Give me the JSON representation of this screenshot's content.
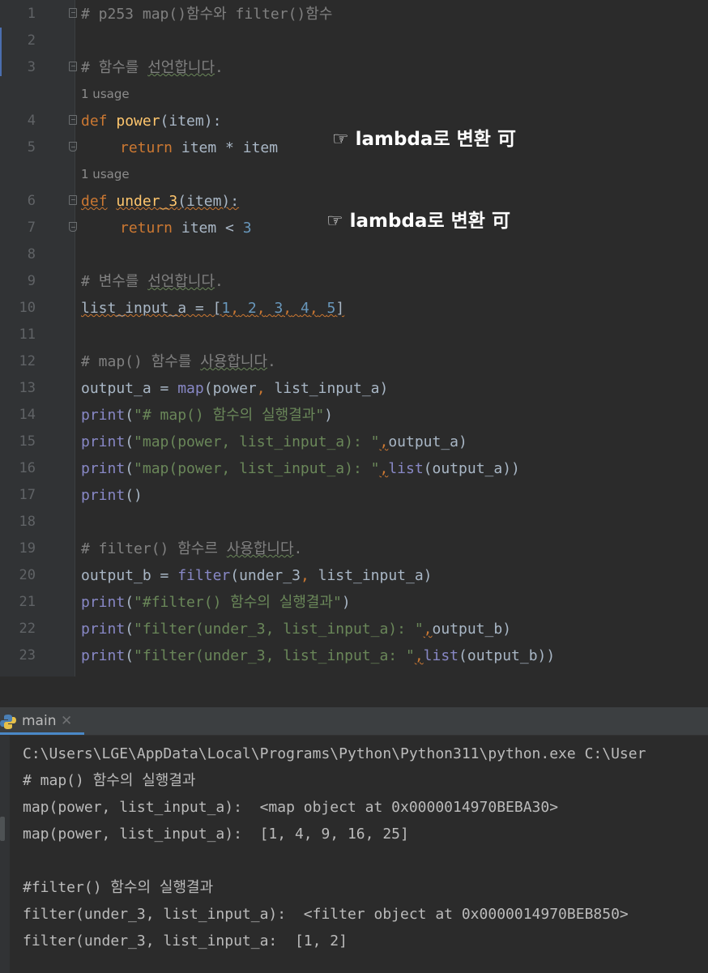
{
  "editor": {
    "line_numbers": [
      "1",
      "2",
      "3",
      "4",
      "5",
      "6",
      "7",
      "8",
      "9",
      "10",
      "11",
      "12",
      "13",
      "14",
      "15",
      "16",
      "17",
      "18",
      "19",
      "20",
      "21",
      "22",
      "23"
    ],
    "usage_hint": "1 usage",
    "annotation": "☞ lambda로 변환 可",
    "code": {
      "l1": "# p253 map()함수와 filter()함수",
      "l3_a": "# ",
      "l3_b": "함수를",
      "l3_c": " ",
      "l3_d": "선언합니다",
      "l3_e": ".",
      "l4_def": "def",
      "l4_name": "power",
      "l4_rest": "(item):",
      "l5_kw": "return",
      "l5_rest": " item * item",
      "l6_def": "def",
      "l6_name": "under_3",
      "l6_rest": "(item):",
      "l7_kw": "return",
      "l7_rest": " item < ",
      "l7_num": "3",
      "l9_a": "# ",
      "l9_b": "변수를",
      "l9_c": " ",
      "l9_d": "선언합니다",
      "l9_e": ".",
      "l10_a": "list_input_a = [",
      "n1": "1",
      "n2": "2",
      "n3": "3",
      "n4": "4",
      "n5": "5",
      "comma": ",",
      "sp": " ",
      "close_br": "]",
      "l12_a": "# map() 함수를 ",
      "l12_b": "사용합니다",
      "l12_c": ".",
      "l13_a": "output_a = ",
      "l13_map": "map",
      "l13_b": "(power",
      "l13_c": " list_input_a)",
      "print": "print",
      "open_p": "(",
      "close_p": ")",
      "l14_str": "\"# map() 함수의 실행결과\"",
      "l15_str": "\"map(power, list_input_a): \"",
      "l15_rest": "output_a)",
      "l16_str": "\"map(power, list_input_a): \"",
      "l16_list": "list",
      "l16_rest": "(output_a))",
      "l17": "()",
      "l19_a": "# filter() 함수르 ",
      "l19_b": "사용합니다",
      "l19_c": ".",
      "l20_a": "output_b = ",
      "l20_filter": "filter",
      "l20_b": "(under_3",
      "l20_c": " list_input_a)",
      "l21_str": "\"#filter() 함수의 실행결과\"",
      "l22_str": "\"filter(under_3, list_input_a): \"",
      "l22_rest": "output_b)",
      "l23_str": "\"filter(under_3, list_input_a: \"",
      "l23_list": "list",
      "l23_rest": "(output_b))"
    }
  },
  "run_panel": {
    "tab_label": "main",
    "tab_close": "✕",
    "icon": "python-icon",
    "output": [
      "C:\\Users\\LGE\\AppData\\Local\\Programs\\Python\\Python311\\python.exe C:\\User",
      "# map() 함수의 실행결과",
      "map(power, list_input_a):  <map object at 0x0000014970BEBA30>",
      "map(power, list_input_a):  [1, 4, 9, 16, 25]",
      "",
      "#filter() 함수의 실행결과",
      "filter(under_3, list_input_a):  <filter object at 0x0000014970BEB850>",
      "filter(under_3, list_input_a:  [1, 2]"
    ]
  },
  "colors": {
    "background": "#2b2b2b",
    "keyword": "#cc7832",
    "function_name": "#ffc66d",
    "builtin": "#8888c6",
    "number": "#6897bb",
    "string": "#6a8759",
    "comment": "#808080",
    "text": "#a9b7c6",
    "tab_accent": "#4a88c7"
  }
}
